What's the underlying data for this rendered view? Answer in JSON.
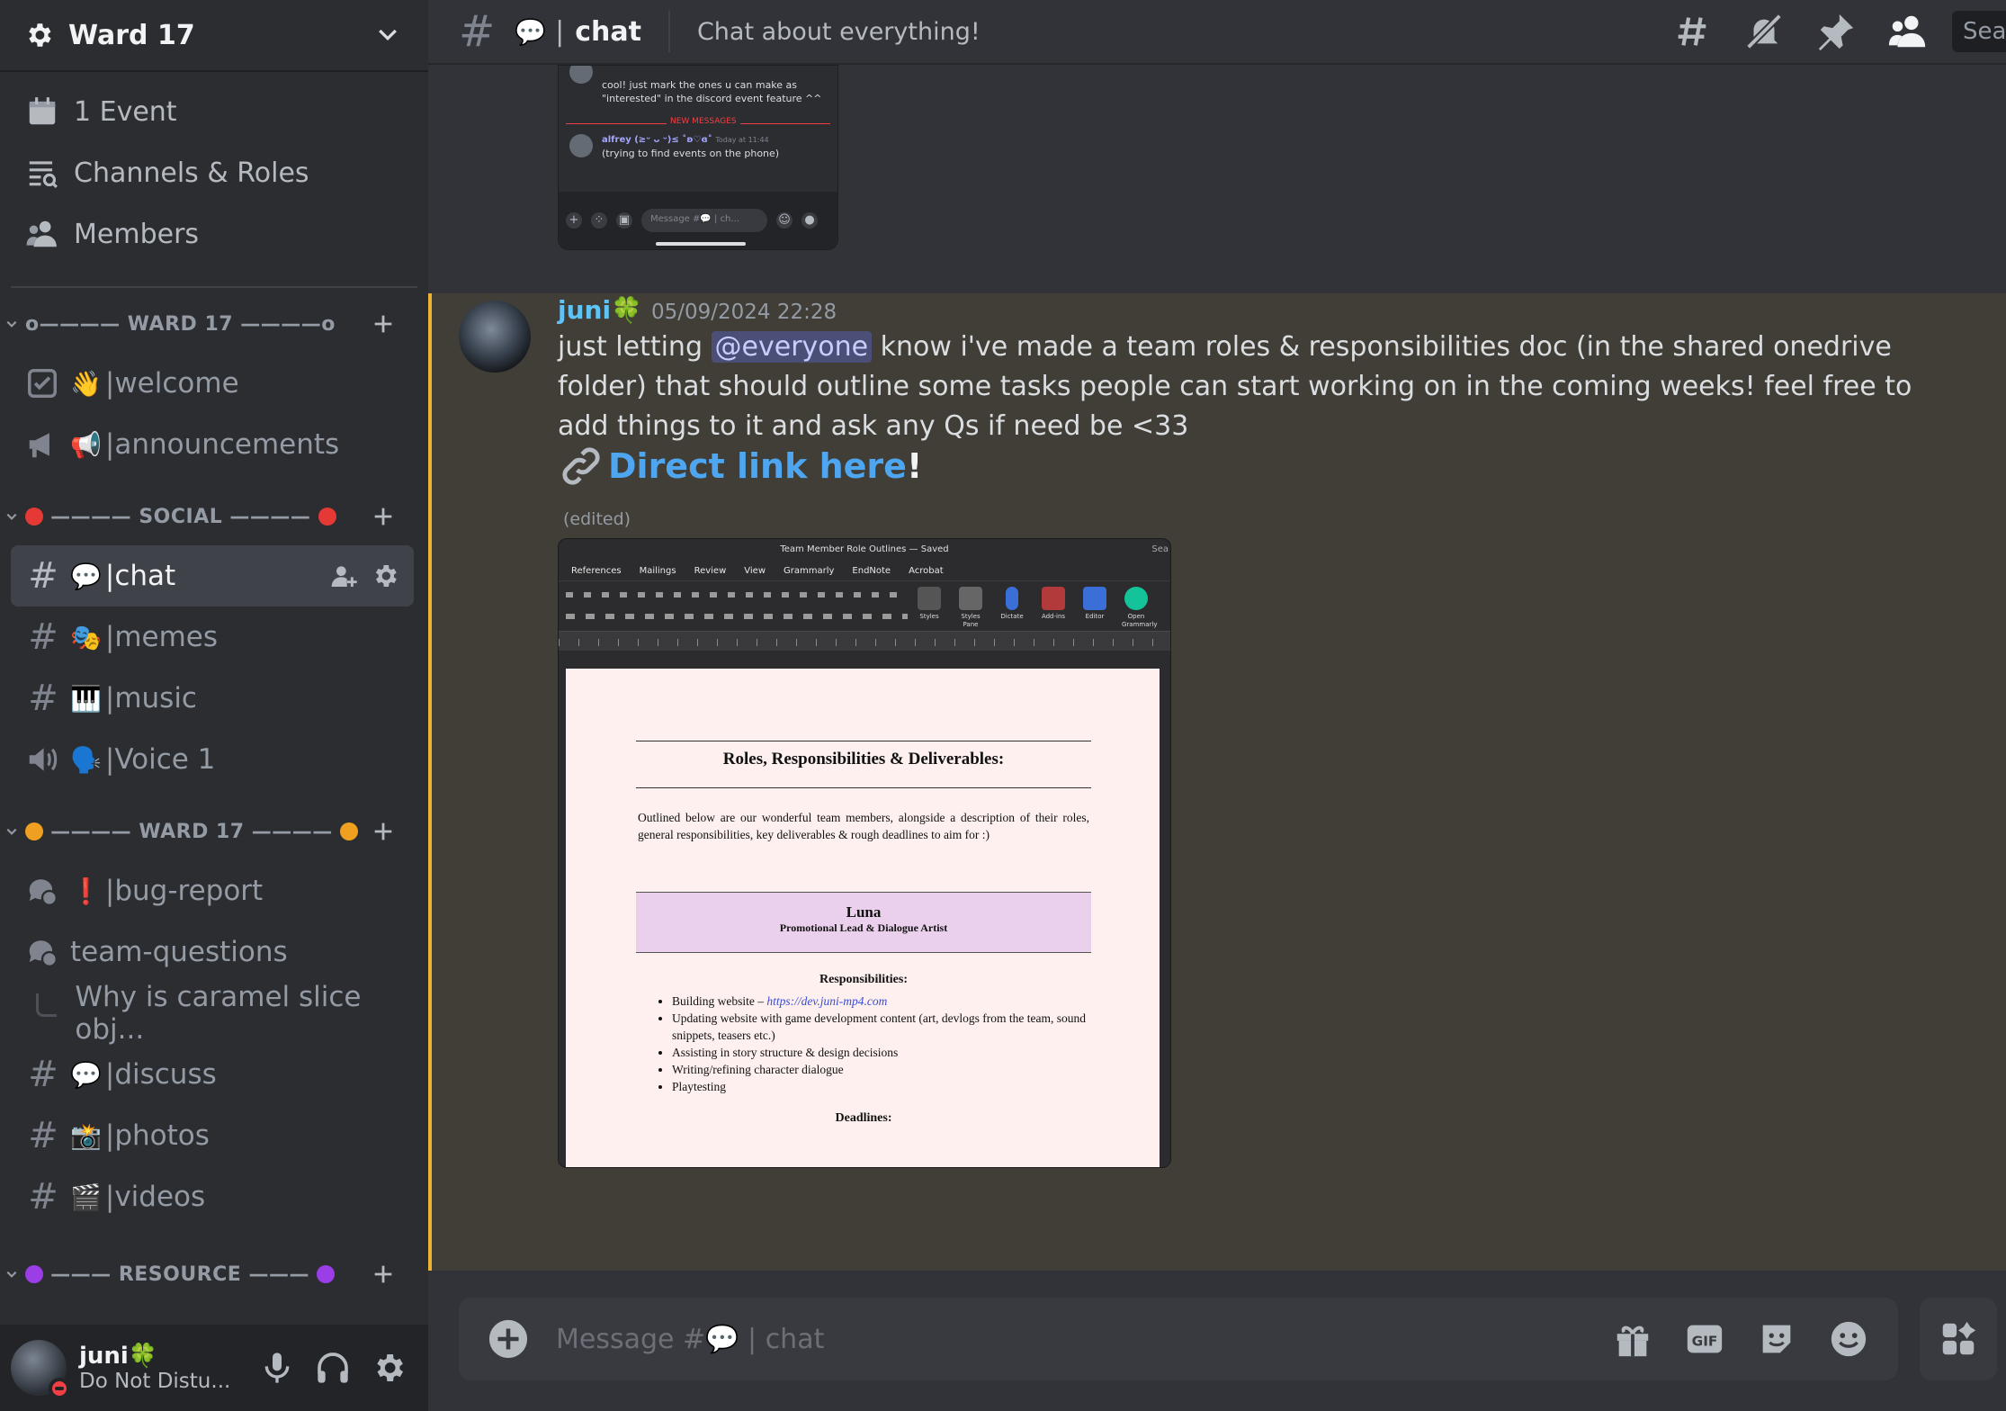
{
  "server": {
    "name": "Ward 17"
  },
  "top_items": [
    {
      "label": "1 Event",
      "icon": "calendar-icon"
    },
    {
      "label": "Channels & Roles",
      "icon": "channels-roles-icon"
    },
    {
      "label": "Members",
      "icon": "members-icon"
    }
  ],
  "categories": {
    "ward17_a": {
      "label": "WARD 17",
      "deco": "o———— WARD 17 ————o"
    },
    "social": {
      "label": "SOCIAL",
      "ball_color": "#e53935"
    },
    "ward17_b": {
      "label": "WARD 17",
      "ball_color": "#f0a020"
    },
    "resource": {
      "label": "RESOURCE",
      "ball_color": "#9b3ee8"
    }
  },
  "channels": {
    "welcome": {
      "emoji": "👋",
      "name": "|welcome"
    },
    "announcements": {
      "emoji": "📢",
      "name": "|announcements"
    },
    "chat": {
      "emoji": "💬",
      "name": "|chat"
    },
    "memes": {
      "emoji": "🎭",
      "name": "|memes"
    },
    "music": {
      "emoji": "🎹",
      "name": "|music"
    },
    "voice1": {
      "emoji": "🗣️",
      "name": "|Voice 1"
    },
    "bug_report": {
      "emoji": "❗",
      "name": "|bug-report"
    },
    "team_questions": {
      "name": "team-questions"
    },
    "thread": {
      "name": "Why is caramel slice obj..."
    },
    "discuss": {
      "emoji": "💬",
      "name": "|discuss"
    },
    "photos": {
      "emoji": "📸",
      "name": "|photos"
    },
    "videos": {
      "emoji": "🎬",
      "name": "|videos"
    }
  },
  "user": {
    "name": "juni🍀",
    "status": "Do Not Distu..."
  },
  "topbar": {
    "channel_emoji": "💬",
    "channel_name": "chat",
    "topic": "Chat about everything!",
    "search": "Sea"
  },
  "prev_embed": {
    "line1": "cool! just mark the ones u can make as",
    "line2": "\"interested\" in the discord event feature ^^",
    "new_messages": "NEW MESSAGES",
    "author": "alfrey (≥ᵕ ᴗ ᵕ)≤ ˚ʚ♡ɞ˚",
    "time": "Today at 11:44",
    "text": "(trying to find events on the phone)",
    "input": "Message #💬 | ch..."
  },
  "message": {
    "author": "juni🍀",
    "timestamp": "05/09/2024 22:28",
    "text_before": "just letting ",
    "mention": "@everyone",
    "text_after": " know i've made a team roles & responsibilities doc (in the shared onedrive folder) that should outline some tasks people can start working on in the coming weeks! feel free to add things to it and ask any Qs if need be <33",
    "link_text": "Direct link here",
    "link_suffix": "!",
    "edited": "(edited)"
  },
  "doc": {
    "title": "Team Member Role Outlines — Saved",
    "search": "Sea",
    "tabs": [
      "References",
      "Mailings",
      "Review",
      "View",
      "Grammarly",
      "EndNote",
      "Acrobat"
    ],
    "ribbon": [
      "Styles",
      "Styles Pane",
      "Dictate",
      "Add-ins",
      "Editor",
      "Open Grammarly"
    ],
    "heading": "Roles, Responsibilities & Deliverables:",
    "intro": "Outlined below are our wonderful team members, alongside a description of their roles, general responsibilities, key deliverables & rough deadlines to aim for :)",
    "member_name": "Luna",
    "member_role": "Promotional Lead & Dialogue Artist",
    "resp_heading": "Responsibilities:",
    "resp_items": [
      "Building website – ",
      "Updating website with game development content (art, devlogs from the team, sound snippets, teasers etc.)",
      "Assisting in story structure & design decisions",
      "Writing/refining character dialogue",
      "Playtesting"
    ],
    "website_link": "https://dev.juni-mp4.com",
    "deadlines": "Deadlines:"
  },
  "composer": {
    "placeholder": "Message #💬 | chat"
  },
  "colors": {
    "mention_bg": "#4b4f78",
    "highlight_bar": "#f0b232",
    "link": "#4ea6f0",
    "author": "#5fc3f5"
  }
}
